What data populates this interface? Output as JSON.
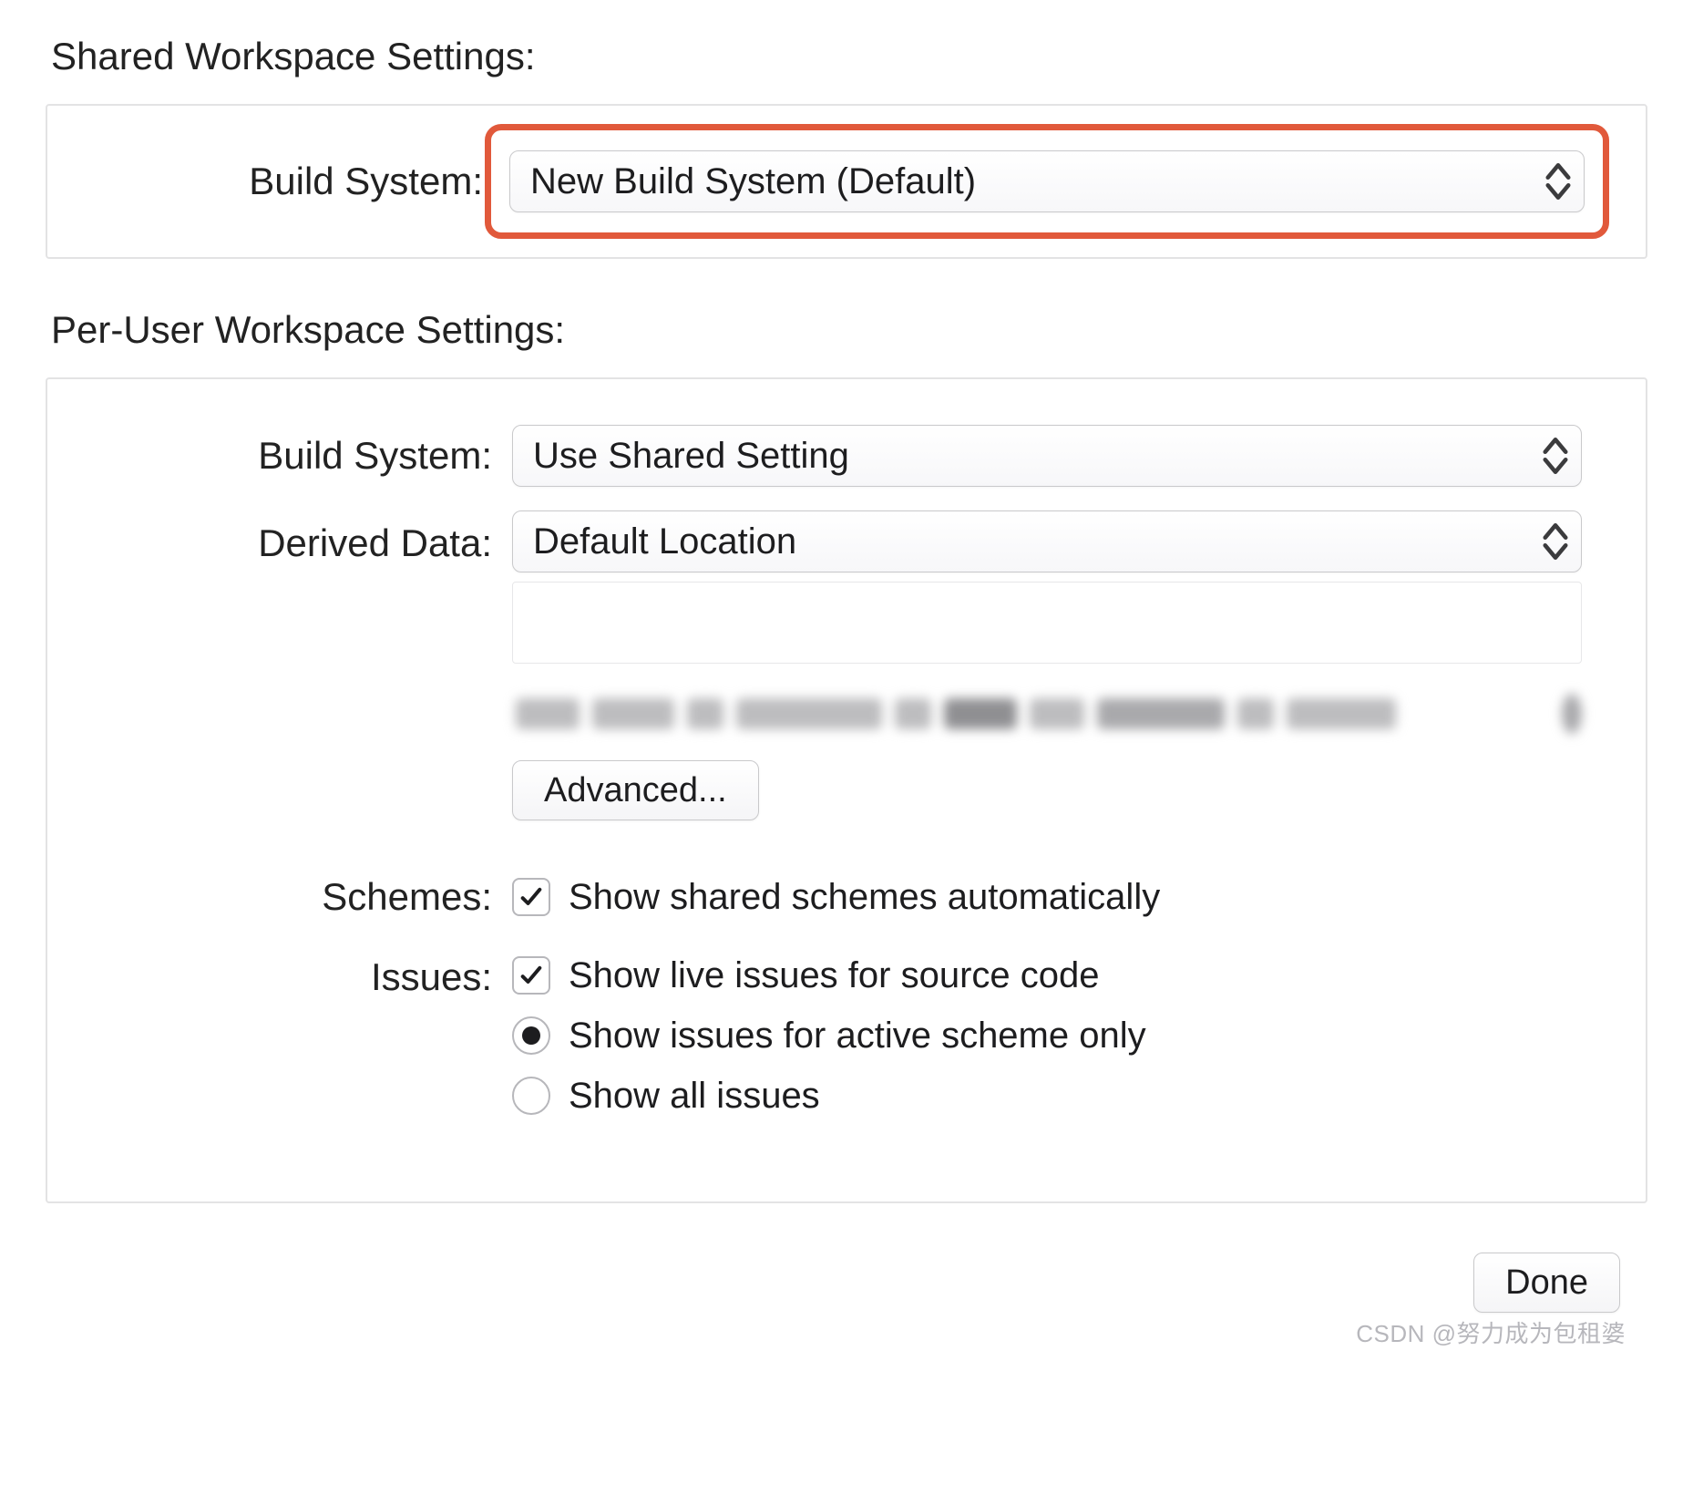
{
  "shared": {
    "title": "Shared Workspace Settings:",
    "build_system_label": "Build System:",
    "build_system_value": "New Build System (Default)"
  },
  "per_user": {
    "title": "Per-User Workspace Settings:",
    "build_system_label": "Build System:",
    "build_system_value": "Use Shared Setting",
    "derived_data_label": "Derived Data:",
    "derived_data_value": "Default Location",
    "advanced_button": "Advanced...",
    "schemes_label": "Schemes:",
    "schemes_checkbox": "Show shared schemes automatically",
    "issues_label": "Issues:",
    "issues_checkbox": "Show live issues for source code",
    "issues_radio_active": "Show issues for active scheme only",
    "issues_radio_all": "Show all issues"
  },
  "footer": {
    "done_button": "Done"
  },
  "watermark": "CSDN @努力成为包租婆"
}
